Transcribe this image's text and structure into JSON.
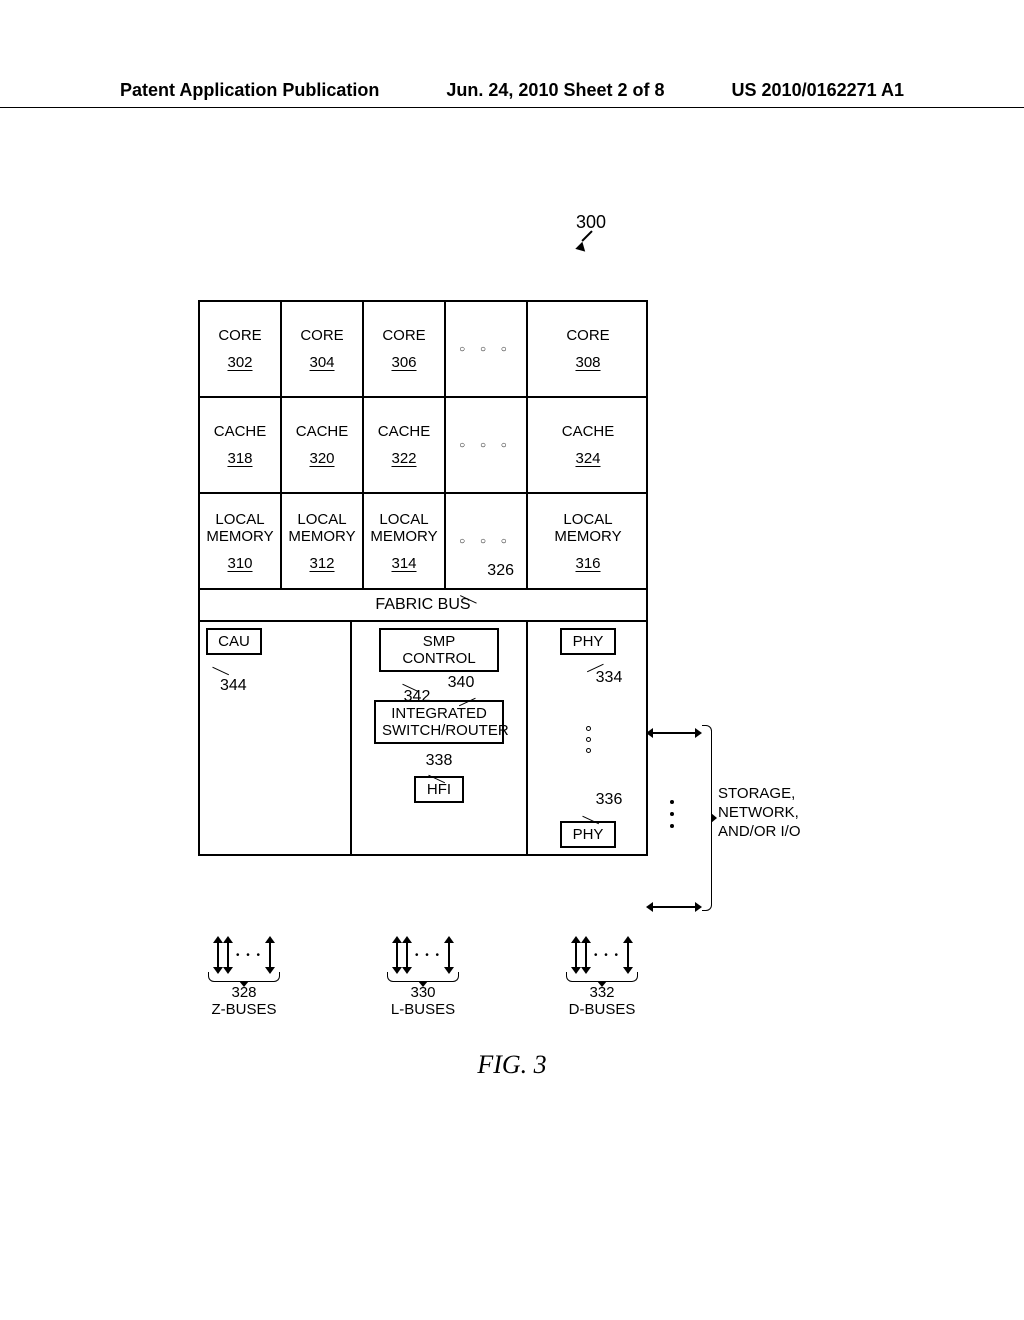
{
  "header": {
    "left": "Patent Application Publication",
    "center": "Jun. 24, 2010  Sheet 2 of 8",
    "right": "US 2010/0162271 A1"
  },
  "ref300": "300",
  "cores": [
    {
      "label": "CORE",
      "num": "302"
    },
    {
      "label": "CORE",
      "num": "304"
    },
    {
      "label": "CORE",
      "num": "306"
    },
    {
      "ell": true
    },
    {
      "label": "CORE",
      "num": "308"
    }
  ],
  "caches": [
    {
      "label": "CACHE",
      "num": "318"
    },
    {
      "label": "CACHE",
      "num": "320"
    },
    {
      "label": "CACHE",
      "num": "322"
    },
    {
      "ell": true
    },
    {
      "label": "CACHE",
      "num": "324"
    }
  ],
  "mems": [
    {
      "label": "LOCAL MEMORY",
      "num": "310"
    },
    {
      "label": "LOCAL MEMORY",
      "num": "312"
    },
    {
      "label": "LOCAL MEMORY",
      "num": "314"
    },
    {
      "ell": true
    },
    {
      "label": "LOCAL MEMORY",
      "num": "316"
    }
  ],
  "fabric": {
    "label": "FABRIC BUS",
    "num": "326"
  },
  "cau": {
    "label": "CAU",
    "num": "344"
  },
  "smp": {
    "label": "SMP CONTROL",
    "num": "342"
  },
  "isr": {
    "label": "INTEGRATED SWITCH/ROUTER",
    "num": "340"
  },
  "hfi": {
    "label": "HFI",
    "num": "338"
  },
  "phy_top": {
    "label": "PHY",
    "num": "334"
  },
  "phy_bot": {
    "label": "PHY",
    "num": "336"
  },
  "buses": [
    {
      "num": "328",
      "label": "Z-BUSES"
    },
    {
      "num": "330",
      "label": "L-BUSES"
    },
    {
      "num": "332",
      "label": "D-BUSES"
    }
  ],
  "ext": {
    "line1": "STORAGE,",
    "line2": "NETWORK,",
    "line3": "AND/OR I/O"
  },
  "figcap": "FIG. 3"
}
